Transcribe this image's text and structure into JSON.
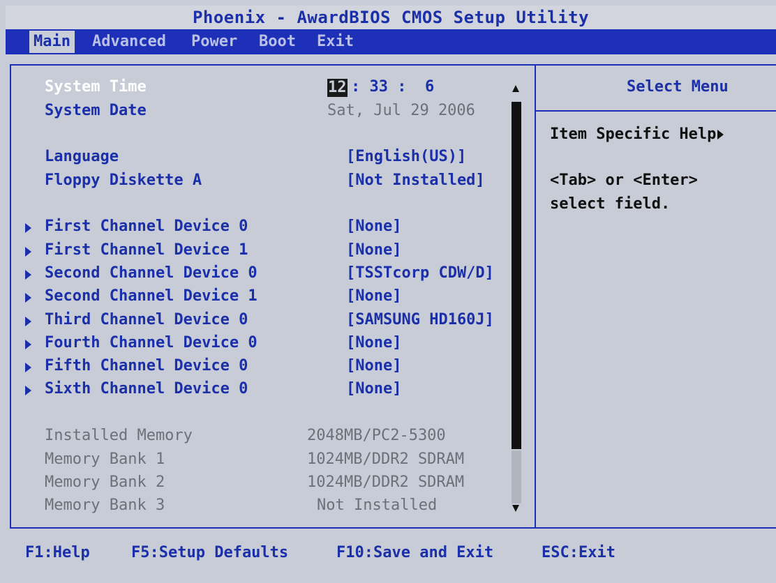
{
  "title": "Phoenix - AwardBIOS CMOS Setup Utility",
  "menu": {
    "items": [
      "Main",
      "Advanced",
      "Power",
      "Boot",
      "Exit"
    ],
    "active": "Main"
  },
  "settings": {
    "system_time": {
      "label": "System Time",
      "hour": "12",
      "rest": ": 33 :  6"
    },
    "system_date": {
      "label": "System Date",
      "value": "Sat, Jul 29 2006"
    },
    "language": {
      "label": "Language",
      "value": "[English(US)]"
    },
    "floppy": {
      "label": "Floppy Diskette A",
      "value": "[Not Installed]"
    },
    "devices": [
      {
        "label": "First Channel Device 0",
        "value": "[None]"
      },
      {
        "label": "First Channel Device 1",
        "value": "[None]"
      },
      {
        "label": "Second Channel Device 0",
        "value": "[TSSTcorp CDW/D]"
      },
      {
        "label": "Second Channel Device 1",
        "value": "[None]"
      },
      {
        "label": "Third Channel Device 0",
        "value": "[SAMSUNG HD160J]"
      },
      {
        "label": "Fourth Channel Device 0",
        "value": "[None]"
      },
      {
        "label": "Fifth Channel Device 0",
        "value": "[None]"
      },
      {
        "label": "Sixth Channel Device 0",
        "value": "[None]"
      }
    ],
    "memory": [
      {
        "label": "Installed Memory",
        "value": "2048MB/PC2-5300"
      },
      {
        "label": "Memory Bank 1",
        "value": "1024MB/DDR2 SDRAM"
      },
      {
        "label": "Memory Bank 2",
        "value": "1024MB/DDR2 SDRAM"
      },
      {
        "label": "Memory Bank 3",
        "value": "Not Installed"
      }
    ]
  },
  "help": {
    "header": "Select Menu",
    "item_specific": "Item Specific Help",
    "line1": "<Tab> or <Enter>",
    "line2": "select field."
  },
  "footer": {
    "help": "F1:Help",
    "defaults": "F5:Setup Defaults",
    "save": "F10:Save and Exit",
    "exit": "ESC:Exit"
  },
  "colors": {
    "accent_blue": "#1e2fb8",
    "panel_bg": "#c7ccd6",
    "text_blue": "#1b2fa8",
    "text_gray": "#6d7079"
  },
  "icons": {
    "submenu": "triangle-right-icon",
    "scroll_up": "triangle-up-icon",
    "scroll_down": "triangle-down-icon"
  }
}
